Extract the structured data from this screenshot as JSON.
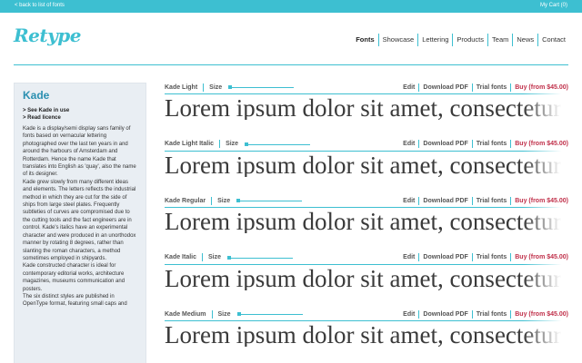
{
  "topbar": {
    "back_label": "< back to list of fonts",
    "cart_label": "My Cart (0)"
  },
  "logo": {
    "text": "Retype"
  },
  "nav": {
    "items": [
      "Fonts",
      "Showcase",
      "Lettering",
      "Products",
      "Team",
      "News",
      "Contact"
    ]
  },
  "sidebar": {
    "title": "Kade",
    "links": [
      "> See Kade in use",
      "> Read licence"
    ],
    "paragraphs": [
      "Kade is a display/semi display sans family of fonts based on vernacular lettering photographed over the last ten years in and around the harbours of Amsterdam and Rotterdam. Hence the name Kade that translates into English as 'quay', also the name of its designer.",
      "Kade grew slowly from many different ideas and elements. The letters reflects the industrial method in which they are cut for the side of ships from large steel plates. Frequently subtleties of curves are compromised due to the cutting tools and the fact engineers are in control. Kade's italics have an experimental character and were produced in an unorthodox manner by rotating 8 degrees, rather than slanting the roman characters, a method sometimes employed in shipyards.",
      "Kade constructed character is ideal for contemporary editorial works, architecture magazines, museums communication and posters.",
      "The six distinct styles are published in OpenType format, featuring small caps and"
    ]
  },
  "actions": {
    "download": "Edit",
    "pdf": "Download PDF",
    "trial": "Trial fonts",
    "buy": "Buy (from $45.00)"
  },
  "size_label": "Size",
  "sample_text": "Lorem ipsum dolor sit amet, consectetur adipiscing",
  "rows": [
    {
      "name": "Kade Light"
    },
    {
      "name": "Kade Light Italic"
    },
    {
      "name": "Kade Regular"
    },
    {
      "name": "Kade Italic"
    },
    {
      "name": "Kade Medium"
    }
  ],
  "colors": {
    "accent": "#3dbfd1",
    "buy": "#c0304a",
    "sidebar_bg": "#e9eef3"
  }
}
